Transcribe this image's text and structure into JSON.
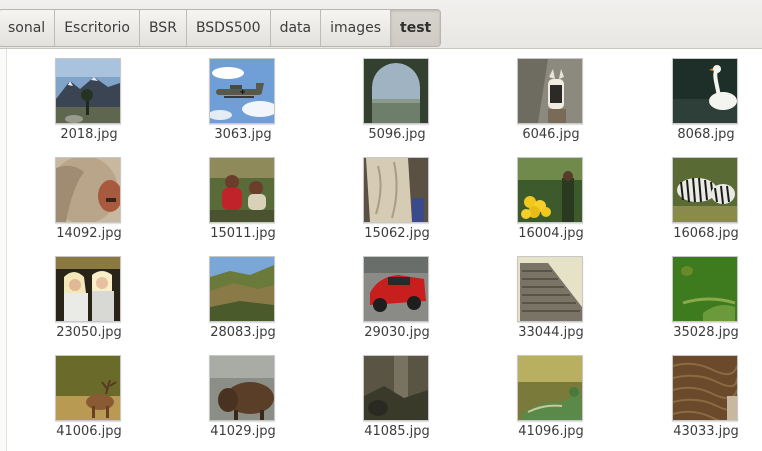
{
  "breadcrumbs": [
    {
      "label": "sonal"
    },
    {
      "label": "Escritorio"
    },
    {
      "label": "BSR"
    },
    {
      "label": "BSDS500"
    },
    {
      "label": "data"
    },
    {
      "label": "images"
    },
    {
      "label": "test"
    }
  ],
  "files": [
    {
      "name": "2018.jpg"
    },
    {
      "name": "3063.jpg"
    },
    {
      "name": "5096.jpg"
    },
    {
      "name": "6046.jpg"
    },
    {
      "name": "8068.jpg"
    },
    {
      "name": "14092.jpg"
    },
    {
      "name": "15011.jpg"
    },
    {
      "name": "15062.jpg"
    },
    {
      "name": "16004.jpg"
    },
    {
      "name": "16068.jpg"
    },
    {
      "name": "23050.jpg"
    },
    {
      "name": "28083.jpg"
    },
    {
      "name": "29030.jpg"
    },
    {
      "name": "33044.jpg"
    },
    {
      "name": "35028.jpg"
    },
    {
      "name": "41006.jpg"
    },
    {
      "name": "41029.jpg"
    },
    {
      "name": "41085.jpg"
    },
    {
      "name": "41096.jpg"
    },
    {
      "name": "43033.jpg"
    }
  ]
}
